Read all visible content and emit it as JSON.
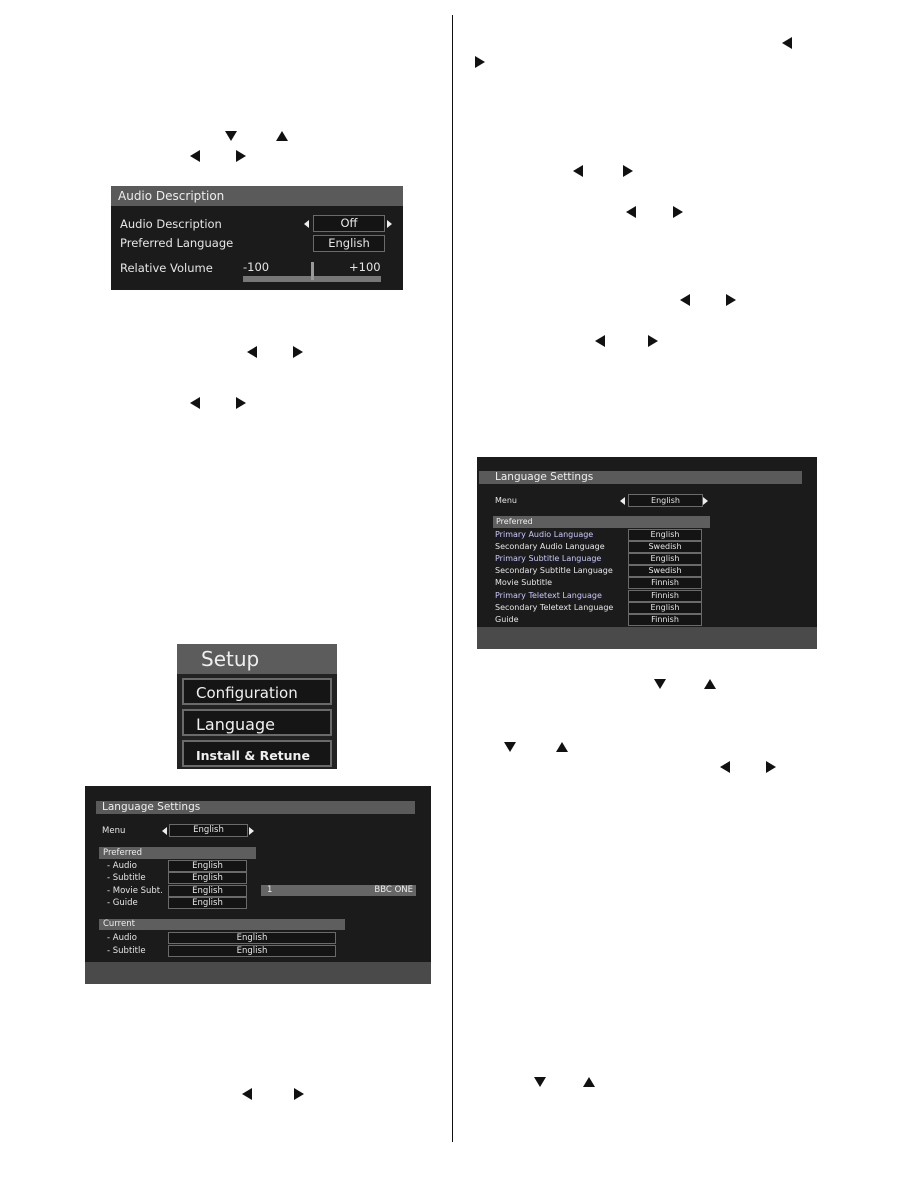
{
  "page": {
    "arrow_glyphs": "remote-control navigation arrows embedded in instruction text"
  },
  "audio_description_screen": {
    "title": "Audio Description",
    "rows": [
      {
        "label": "Audio Description",
        "value": "Off",
        "has_arrows": true
      },
      {
        "label": "Preferred Language",
        "value": "English",
        "has_arrows": false
      }
    ],
    "relative_volume": {
      "label": "Relative Volume",
      "min_label": "-100",
      "max_label": "+100",
      "value": 0
    }
  },
  "setup_menu": {
    "title": "Setup",
    "items": [
      "Configuration",
      "Language",
      "Install & Retune"
    ]
  },
  "language_settings_simple": {
    "title": "Language Settings",
    "menu_label": "Menu",
    "menu_value": "English",
    "preferred_header": "Preferred",
    "preferred_rows": [
      {
        "label": "- Audio",
        "value": "English"
      },
      {
        "label": "- Subtitle",
        "value": "English"
      },
      {
        "label": "- Movie Subt.",
        "value": "English"
      },
      {
        "label": "- Guide",
        "value": "English"
      }
    ],
    "channel_bar": {
      "number": "1",
      "name": "BBC ONE"
    },
    "current_header": "Current",
    "current_rows": [
      {
        "label": "- Audio",
        "value": "English"
      },
      {
        "label": "- Subtitle",
        "value": "English"
      }
    ]
  },
  "language_settings_advanced": {
    "title": "Language Settings",
    "menu_label": "Menu",
    "menu_value": "English",
    "preferred_header": "Preferred",
    "rows": [
      {
        "label": "Primary Audio Language",
        "value": "English"
      },
      {
        "label": "Secondary Audio Language",
        "value": "Swedish"
      },
      {
        "label": "Primary Subtitle Language",
        "value": "English"
      },
      {
        "label": "Secondary Subtitle Language",
        "value": "Swedish"
      },
      {
        "label": "Movie Subtitle",
        "value": "Finnish"
      },
      {
        "label": "Primary Teletext Language",
        "value": "Finnish"
      },
      {
        "label": "Secondary Teletext Language",
        "value": "English"
      },
      {
        "label": "Guide",
        "value": "Finnish"
      }
    ]
  }
}
